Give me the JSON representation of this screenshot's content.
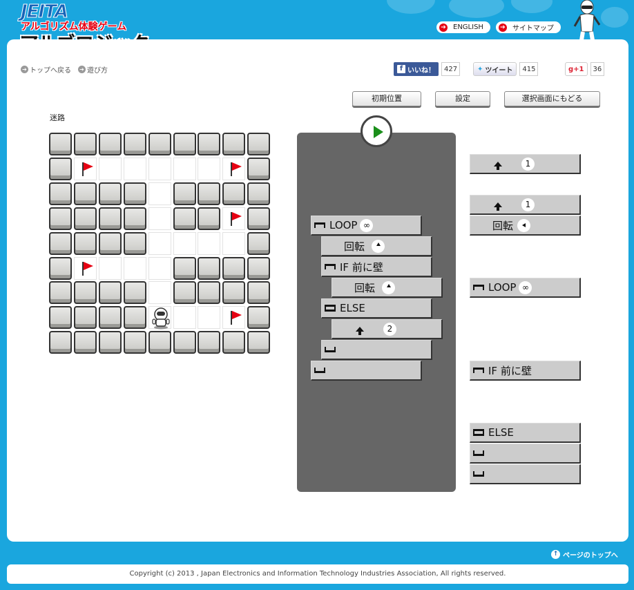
{
  "header": {
    "logo_brand": "JEITA",
    "logo_subtitle": "アルゴリズム体験ゲーム",
    "logo_title": "アルゴロジック",
    "links": [
      {
        "label": "ENGLISH"
      },
      {
        "label": "サイトマップ"
      }
    ]
  },
  "nav": {
    "top_label": "トップへ戻る",
    "howto_label": "遊び方"
  },
  "social": {
    "facebook_label": "いいね！",
    "facebook_count": "427",
    "twitter_label": "ツイート",
    "twitter_count": "415",
    "gplus_label": "+1",
    "gplus_count": "36"
  },
  "controls": {
    "reset_label": "初期位置",
    "settings_label": "設定",
    "back_label": "選択画面にもどる"
  },
  "maze": {
    "label": "迷路",
    "rows": [
      "WWWWWWWWW",
      "WFFFFFFFW",
      "WWWWFWWWW",
      "WWWWFWWFW",
      "WWWWFFFFW",
      "WFFFFWWWW",
      "WWWWFWWWW",
      "WWWWRFFFW",
      "WWWWWWWWW"
    ],
    "flags": [
      [
        1,
        1
      ],
      [
        1,
        7
      ],
      [
        3,
        7
      ],
      [
        5,
        1
      ],
      [
        7,
        7
      ]
    ],
    "robot": [
      7,
      4
    ]
  },
  "program": {
    "blocks": [
      {
        "kind": "loop",
        "label": "LOOP",
        "badge": "∞"
      },
      {
        "kind": "turn",
        "label": "回転",
        "dir": "up"
      },
      {
        "kind": "if",
        "label": "IF 前に壁"
      },
      {
        "kind": "turn",
        "label": "回転",
        "dir": "up"
      },
      {
        "kind": "else",
        "label": "ELSE"
      },
      {
        "kind": "move",
        "badge": "2"
      },
      {
        "kind": "end"
      },
      {
        "kind": "end"
      }
    ]
  },
  "palette": {
    "move1": {
      "badge": "1"
    },
    "move2": {
      "badge": "1"
    },
    "turn": {
      "label": "回転"
    },
    "loop": {
      "label": "LOOP",
      "badge": "∞"
    },
    "if": {
      "label": "IF 前に壁"
    },
    "else": {
      "label": "ELSE"
    }
  },
  "footer": {
    "page_top": "ページのトップへ",
    "copyright": "Copyright (c) 2013 , Japan Electronics and Information Technology Industries Association, All rights reserved."
  },
  "colors": {
    "background": "#1aa6de",
    "flag": "#e60012",
    "play": "#1a8f1a",
    "program_bg": "#666666"
  }
}
